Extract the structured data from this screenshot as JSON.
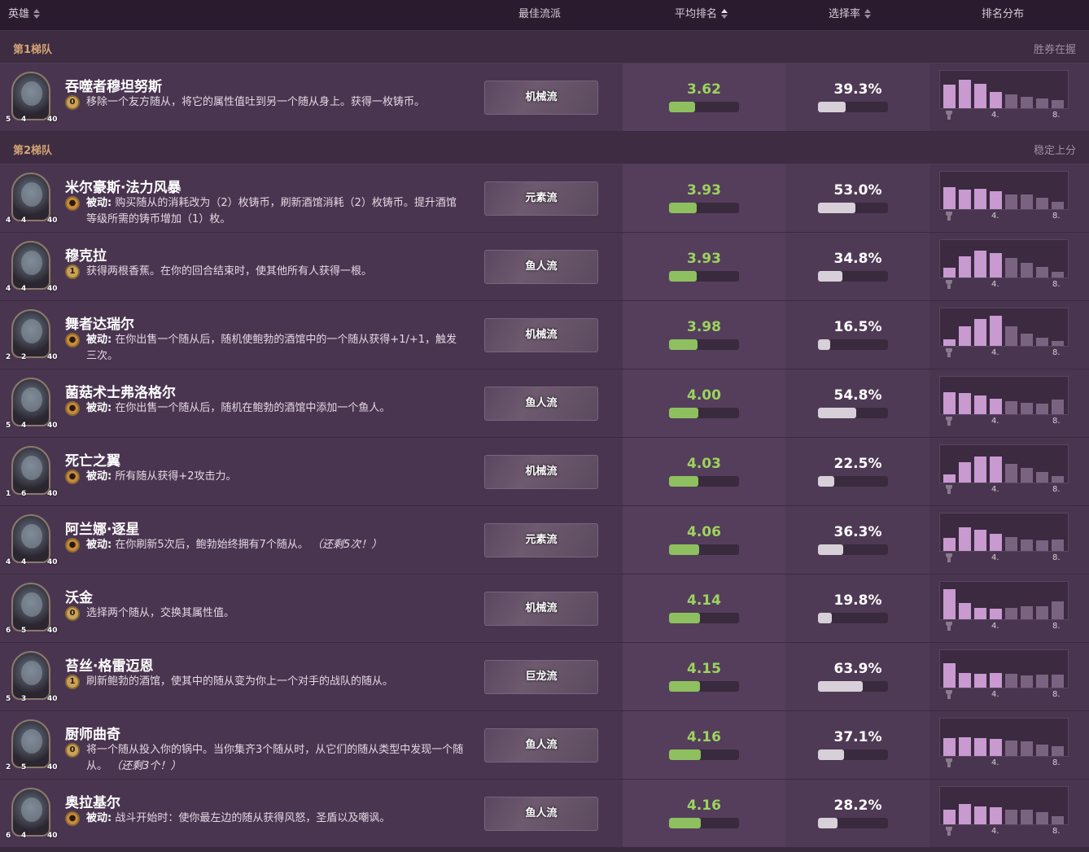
{
  "header": {
    "hero": "英雄",
    "best_strategy": "最佳流派",
    "avg_rank": "平均排名",
    "pick_rate": "选择率",
    "rank_dist": "排名分布"
  },
  "tiers": [
    {
      "name": "第1梯队",
      "desc": "胜券在握",
      "heroes": [
        {
          "name": "吞噬者穆坦努斯",
          "coin": "0",
          "coin_type": "active",
          "desc_prefix": "",
          "desc": "移除一个友方随从，将它的属性值吐到另一个随从身上。获得一枚铸币。",
          "desc_suffix": "",
          "atk": "5",
          "hp": "4",
          "armor": "40",
          "strategy": "机械流",
          "avg_rank": "3.62",
          "rank_fill": 0.37,
          "pick_rate": "39.3%",
          "pick_fill": 0.393,
          "dist": [
            0.72,
            0.88,
            0.74,
            0.5,
            0.42,
            0.34,
            0.3,
            0.24
          ]
        }
      ]
    },
    {
      "name": "第2梯队",
      "desc": "稳定上分",
      "heroes": [
        {
          "name": "米尔豪斯·法力风暴",
          "coin": "",
          "coin_type": "passive",
          "desc_prefix": "被动:",
          "desc": "购买随从的消耗改为（2）枚铸币，刷新酒馆消耗（2）枚铸币。提升酒馆等级所需的铸币增加（1）枚。",
          "desc_suffix": "",
          "atk": "4",
          "hp": "4",
          "armor": "40",
          "strategy": "元素流",
          "avg_rank": "3.93",
          "rank_fill": 0.4,
          "pick_rate": "53.0%",
          "pick_fill": 0.53,
          "dist": [
            0.68,
            0.6,
            0.62,
            0.56,
            0.46,
            0.46,
            0.36,
            0.22
          ]
        },
        {
          "name": "穆克拉",
          "coin": "1",
          "coin_type": "active",
          "desc_prefix": "",
          "desc": "获得两根香蕉。在你的回合结束时，使其他所有人获得一根。",
          "desc_suffix": "",
          "atk": "4",
          "hp": "4",
          "armor": "40",
          "strategy": "鱼人流",
          "avg_rank": "3.93",
          "rank_fill": 0.4,
          "pick_rate": "34.8%",
          "pick_fill": 0.348,
          "dist": [
            0.3,
            0.66,
            0.82,
            0.76,
            0.6,
            0.44,
            0.32,
            0.18
          ]
        },
        {
          "name": "舞者达瑞尔",
          "coin": "",
          "coin_type": "passive",
          "desc_prefix": "被动:",
          "desc": "在你出售一个随从后，随机使鲍勃的酒馆中的一个随从获得+1/+1，触发 三次。",
          "desc_suffix": "",
          "atk": "2",
          "hp": "2",
          "armor": "40",
          "strategy": "机械流",
          "avg_rank": "3.98",
          "rank_fill": 0.41,
          "pick_rate": "16.5%",
          "pick_fill": 0.165,
          "dist": [
            0.2,
            0.6,
            0.82,
            0.92,
            0.6,
            0.38,
            0.24,
            0.14
          ]
        },
        {
          "name": "菌菇术士弗洛格尔",
          "coin": "",
          "coin_type": "passive",
          "desc_prefix": "被动:",
          "desc": "在你出售一个随从后，随机在鲍勃的酒馆中添加一个鱼人。",
          "desc_suffix": "",
          "atk": "5",
          "hp": "4",
          "armor": "40",
          "strategy": "鱼人流",
          "avg_rank": "4.00",
          "rank_fill": 0.42,
          "pick_rate": "54.8%",
          "pick_fill": 0.548,
          "dist": [
            0.68,
            0.64,
            0.58,
            0.48,
            0.4,
            0.34,
            0.32,
            0.46
          ]
        },
        {
          "name": "死亡之翼",
          "coin": "",
          "coin_type": "passive",
          "desc_prefix": "被动:",
          "desc": "所有随从获得+2攻击力。",
          "desc_suffix": "",
          "atk": "1",
          "hp": "6",
          "armor": "40",
          "strategy": "机械流",
          "avg_rank": "4.03",
          "rank_fill": 0.42,
          "pick_rate": "22.5%",
          "pick_fill": 0.225,
          "dist": [
            0.26,
            0.62,
            0.8,
            0.8,
            0.58,
            0.44,
            0.32,
            0.2
          ]
        },
        {
          "name": "阿兰娜·逐星",
          "coin": "",
          "coin_type": "passive",
          "desc_prefix": "被动:",
          "desc": "在你刷新5次后，鲍勃始终拥有7个随从。",
          "desc_suffix": "（还剩5次！）",
          "atk": "4",
          "hp": "4",
          "armor": "40",
          "strategy": "元素流",
          "avg_rank": "4.06",
          "rank_fill": 0.43,
          "pick_rate": "36.3%",
          "pick_fill": 0.363,
          "dist": [
            0.4,
            0.72,
            0.64,
            0.52,
            0.42,
            0.36,
            0.32,
            0.36
          ]
        },
        {
          "name": "沃金",
          "coin": "0",
          "coin_type": "active",
          "desc_prefix": "",
          "desc": "选择两个随从，交换其属性值。",
          "desc_suffix": "",
          "atk": "6",
          "hp": "5",
          "armor": "40",
          "strategy": "机械流",
          "avg_rank": "4.14",
          "rank_fill": 0.44,
          "pick_rate": "19.8%",
          "pick_fill": 0.198,
          "dist": [
            0.92,
            0.5,
            0.34,
            0.32,
            0.36,
            0.4,
            0.4,
            0.56
          ]
        },
        {
          "name": "苔丝·格雷迈恩",
          "coin": "1",
          "coin_type": "active",
          "desc_prefix": "",
          "desc": "刷新鲍勃的酒馆，使其中的随从变为你上一个对手的战队的随从。",
          "desc_suffix": "",
          "atk": "5",
          "hp": "3",
          "armor": "40",
          "strategy": "巨龙流",
          "avg_rank": "4.15",
          "rank_fill": 0.44,
          "pick_rate": "63.9%",
          "pick_fill": 0.639,
          "dist": [
            0.76,
            0.46,
            0.42,
            0.44,
            0.42,
            0.38,
            0.4,
            0.4
          ]
        },
        {
          "name": "厨师曲奇",
          "coin": "0",
          "coin_type": "active",
          "desc_prefix": "",
          "desc": "将一个随从投入你的锅中。当你集齐3个随从时，从它们的随从类型中发现一个随从。",
          "desc_suffix": "（还剩3个！）",
          "atk": "2",
          "hp": "5",
          "armor": "40",
          "strategy": "鱼人流",
          "avg_rank": "4.16",
          "rank_fill": 0.45,
          "pick_rate": "37.1%",
          "pick_fill": 0.371,
          "dist": [
            0.56,
            0.58,
            0.54,
            0.52,
            0.48,
            0.44,
            0.36,
            0.3
          ]
        },
        {
          "name": "奥拉基尔",
          "coin": "",
          "coin_type": "passive",
          "desc_prefix": "被动:",
          "desc": "战斗开始时：使你最左边的随从获得风怒，圣盾以及嘲讽。",
          "desc_suffix": "",
          "atk": "6",
          "hp": "4",
          "armor": "40",
          "strategy": "鱼人流",
          "avg_rank": "4.16",
          "rank_fill": 0.45,
          "pick_rate": "28.2%",
          "pick_fill": 0.282,
          "dist": [
            0.46,
            0.62,
            0.54,
            0.52,
            0.44,
            0.44,
            0.38,
            0.26
          ]
        }
      ]
    }
  ],
  "dist_labels": {
    "mid": "4.",
    "end": "8."
  },
  "colors": {
    "rank_green": "#9bd45e",
    "tier_gold": "#d4a574",
    "dist_top": "#c89ad0",
    "dist_bottom": "#7a6380"
  }
}
